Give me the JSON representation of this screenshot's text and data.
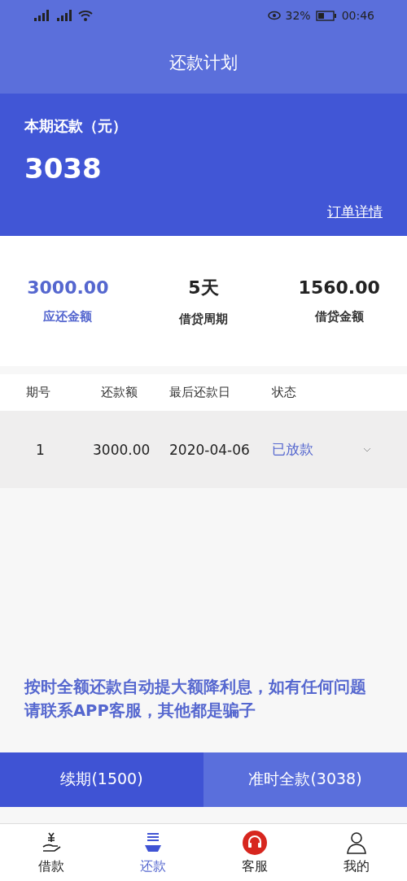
{
  "status_bar": {
    "battery": "32%",
    "time": "00:46"
  },
  "header": {
    "title": "还款计划"
  },
  "current": {
    "label": "本期还款（元）",
    "amount": "3038",
    "link": "订单详情"
  },
  "summary": [
    {
      "value": "3000.00",
      "label": "应还金额",
      "highlight": true
    },
    {
      "value": "5天",
      "label": "借贷周期",
      "highlight": false
    },
    {
      "value": "1560.00",
      "label": "借贷金额",
      "highlight": false
    }
  ],
  "table": {
    "columns": [
      "期号",
      "还款额",
      "最后还款日",
      "状态"
    ],
    "rows": [
      {
        "cells": [
          "1",
          "3000.00",
          "2020-04-06",
          "已放款"
        ]
      }
    ]
  },
  "notice": "按时全额还款自动提大额降利息，如有任何问题请联系APP客服，其他都是骗子",
  "actions": [
    {
      "label": "续期(1500)",
      "kind": "dark"
    },
    {
      "label": "准时全款(3038)",
      "kind": "light"
    }
  ],
  "tabs": [
    {
      "label": "借款",
      "kind": "loan",
      "selected": false
    },
    {
      "label": "还款",
      "kind": "repay",
      "selected": true
    },
    {
      "label": "客服",
      "kind": "service",
      "selected": false
    },
    {
      "label": "我的",
      "kind": "user",
      "selected": false
    }
  ]
}
